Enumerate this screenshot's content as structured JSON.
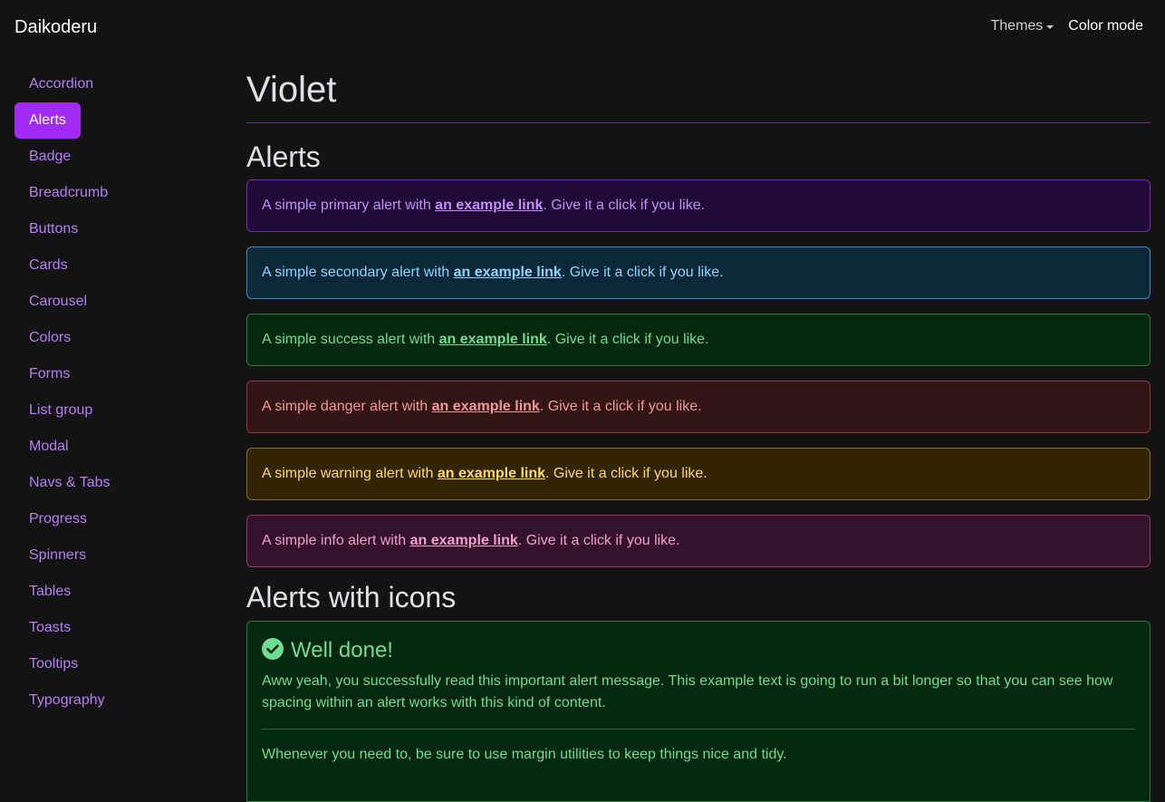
{
  "navbar": {
    "brand": "Daikoderu",
    "themes_label": "Themes",
    "color_mode_label": "Color mode"
  },
  "sidebar": {
    "items": [
      {
        "label": "Accordion",
        "active": false
      },
      {
        "label": "Alerts",
        "active": true
      },
      {
        "label": "Badge",
        "active": false
      },
      {
        "label": "Breadcrumb",
        "active": false
      },
      {
        "label": "Buttons",
        "active": false
      },
      {
        "label": "Cards",
        "active": false
      },
      {
        "label": "Carousel",
        "active": false
      },
      {
        "label": "Colors",
        "active": false
      },
      {
        "label": "Forms",
        "active": false
      },
      {
        "label": "List group",
        "active": false
      },
      {
        "label": "Modal",
        "active": false
      },
      {
        "label": "Navs & Tabs",
        "active": false
      },
      {
        "label": "Progress",
        "active": false
      },
      {
        "label": "Spinners",
        "active": false
      },
      {
        "label": "Tables",
        "active": false
      },
      {
        "label": "Toasts",
        "active": false
      },
      {
        "label": "Tooltips",
        "active": false
      },
      {
        "label": "Typography",
        "active": false
      }
    ]
  },
  "main": {
    "page_title": "Violet",
    "alerts_heading": "Alerts",
    "link_text": "an example link",
    "after_link": ". Give it a click if you like.",
    "alerts": [
      {
        "variant": "primary",
        "before": "A simple primary alert with "
      },
      {
        "variant": "secondary",
        "before": "A simple secondary alert with "
      },
      {
        "variant": "success",
        "before": "A simple success alert with "
      },
      {
        "variant": "danger",
        "before": "A simple danger alert with "
      },
      {
        "variant": "warning",
        "before": "A simple warning alert with "
      },
      {
        "variant": "info",
        "before": "A simple info alert with "
      }
    ],
    "icons_heading": "Alerts with icons",
    "icon_alert": {
      "icon": "check-circle-icon",
      "heading": "Well done!",
      "body": "Aww yeah, you successfully read this important alert message. This example text is going to run a bit longer so that you can see how spacing within an alert works with this kind of content.",
      "footer": "Whenever you need to, be sure to use margin utilities to keep things nice and tidy."
    }
  },
  "colors": {
    "background": "#131313",
    "accent": "#a12bf5",
    "sidebar_link": "#b77df5"
  }
}
